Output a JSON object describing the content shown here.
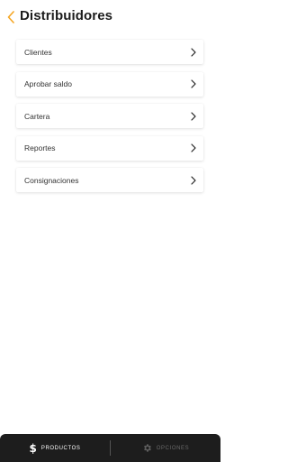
{
  "header": {
    "title": "Distribuidores",
    "back_icon": "chevron-left-icon",
    "accent_color": "#F5A623"
  },
  "menu": {
    "items": [
      {
        "label": "Clientes"
      },
      {
        "label": "Aprobar saldo"
      },
      {
        "label": "Cartera"
      },
      {
        "label": "Reportes"
      },
      {
        "label": "Consignaciones"
      }
    ]
  },
  "bottom_nav": {
    "background": "#1d1d1d",
    "tabs": [
      {
        "label": "PRODUCTOS",
        "icon": "dollar-icon",
        "active": true
      },
      {
        "label": "OPCIONES",
        "icon": "gear-icon",
        "active": false
      }
    ],
    "dollar_glyph": "$"
  }
}
